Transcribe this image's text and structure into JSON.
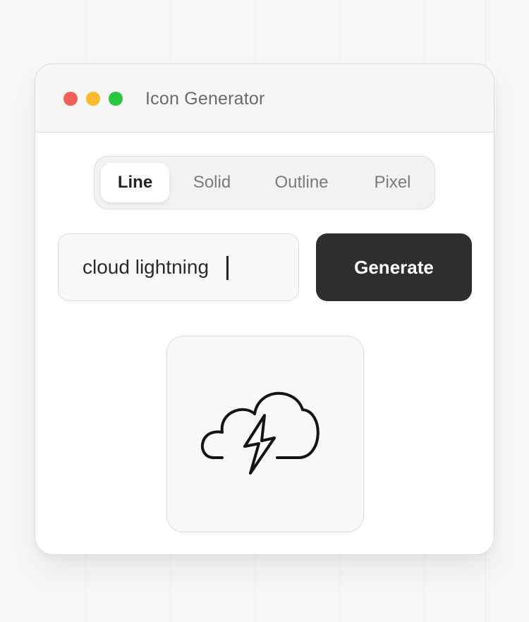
{
  "window": {
    "title": "Icon Generator"
  },
  "traffic_lights": {
    "close_color": "#f25f58",
    "minimize_color": "#fbbb2e",
    "maximize_color": "#2bc641"
  },
  "style_tabs": {
    "selected": "Line",
    "items": [
      {
        "label": "Line"
      },
      {
        "label": "Solid"
      },
      {
        "label": "Outline"
      },
      {
        "label": "Pixel"
      }
    ]
  },
  "prompt_input": {
    "value": "cloud lightning",
    "placeholder": ""
  },
  "generate_button": {
    "label": "Generate",
    "color": "#2e2e2e"
  },
  "preview": {
    "icon": "cloud-lightning-icon",
    "style": "line"
  }
}
